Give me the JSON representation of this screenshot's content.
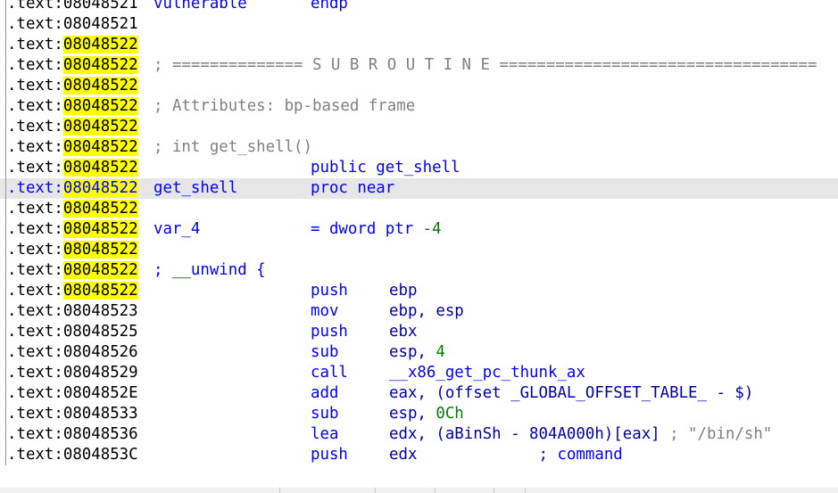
{
  "view": "IDA View - disassembly",
  "rows": [
    {
      "seg": ".text",
      "addr": "08048521",
      "hl": false,
      "label": "vulnerable",
      "mnem": "endp",
      "ops": []
    },
    {
      "seg": ".text",
      "addr": "08048521",
      "hl": false
    },
    {
      "seg": ".text",
      "addr": "08048522",
      "hl": true
    },
    {
      "seg": ".text",
      "addr": "08048522",
      "hl": true,
      "comment": "; ============== S U B R O U T I N E =================================="
    },
    {
      "seg": ".text",
      "addr": "08048522",
      "hl": true
    },
    {
      "seg": ".text",
      "addr": "08048522",
      "hl": true,
      "comment": "; Attributes: bp-based frame"
    },
    {
      "seg": ".text",
      "addr": "08048522",
      "hl": true
    },
    {
      "seg": ".text",
      "addr": "08048522",
      "hl": true,
      "comment": "; int get_shell()"
    },
    {
      "seg": ".text",
      "addr": "08048522",
      "hl": true,
      "mnem": "public get_shell",
      "ops": []
    },
    {
      "seg": ".text",
      "addr": "08048522",
      "hl": true,
      "selected": true,
      "label": "get_shell",
      "mnem": "proc near",
      "ops": []
    },
    {
      "seg": ".text",
      "addr": "08048522",
      "hl": true
    },
    {
      "seg": ".text",
      "addr": "08048522",
      "hl": true,
      "label": "var_4",
      "mnem": "= dword ptr ",
      "mnemNum": "-4",
      "ops": []
    },
    {
      "seg": ".text",
      "addr": "08048522",
      "hl": true
    },
    {
      "seg": ".text",
      "addr": "08048522",
      "hl": true,
      "commentBlue": "; __unwind {"
    },
    {
      "seg": ".text",
      "addr": "08048522",
      "hl": true,
      "mnem": "push",
      "ops": [
        {
          "t": "ebp",
          "c": "reg"
        }
      ]
    },
    {
      "seg": ".text",
      "addr": "08048523",
      "hl": false,
      "mnem": "mov",
      "ops": [
        {
          "t": "ebp, esp",
          "c": "reg"
        }
      ]
    },
    {
      "seg": ".text",
      "addr": "08048525",
      "hl": false,
      "mnem": "push",
      "ops": [
        {
          "t": "ebx",
          "c": "reg"
        }
      ]
    },
    {
      "seg": ".text",
      "addr": "08048526",
      "hl": false,
      "mnem": "sub",
      "ops": [
        {
          "t": "esp, ",
          "c": "reg"
        },
        {
          "t": "4",
          "c": "num"
        }
      ]
    },
    {
      "seg": ".text",
      "addr": "08048529",
      "hl": false,
      "mnem": "call",
      "ops": [
        {
          "t": "__x86_get_pc_thunk_ax",
          "c": "blue"
        }
      ]
    },
    {
      "seg": ".text",
      "addr": "0804852E",
      "hl": false,
      "mnem": "add",
      "ops": [
        {
          "t": "eax, (offset _GLOBAL_OFFSET_TABLE_ - $)",
          "c": "reg"
        }
      ]
    },
    {
      "seg": ".text",
      "addr": "08048533",
      "hl": false,
      "mnem": "sub",
      "ops": [
        {
          "t": "esp, ",
          "c": "reg"
        },
        {
          "t": "0Ch",
          "c": "num"
        }
      ]
    },
    {
      "seg": ".text",
      "addr": "08048536",
      "hl": false,
      "mnem": "lea",
      "ops": [
        {
          "t": "edx, (aBinSh - 804A000h)[eax] ",
          "c": "reg"
        },
        {
          "t": "; \"/bin/sh\"",
          "c": "comment"
        }
      ]
    },
    {
      "seg": ".text",
      "addr": "0804853C",
      "hl": false,
      "mnem": "push",
      "ops": [
        {
          "t": "edx",
          "c": "reg"
        },
        {
          "t": "             ",
          "c": "reg"
        },
        {
          "t": "; command",
          "c": "blue"
        }
      ]
    }
  ],
  "colors": {
    "highlight": "#ffff00",
    "name_blue": "#0000ff",
    "operand": "#0000aa",
    "number": "#008000",
    "comment": "#808080",
    "selected_row": "#e6e6e6"
  }
}
